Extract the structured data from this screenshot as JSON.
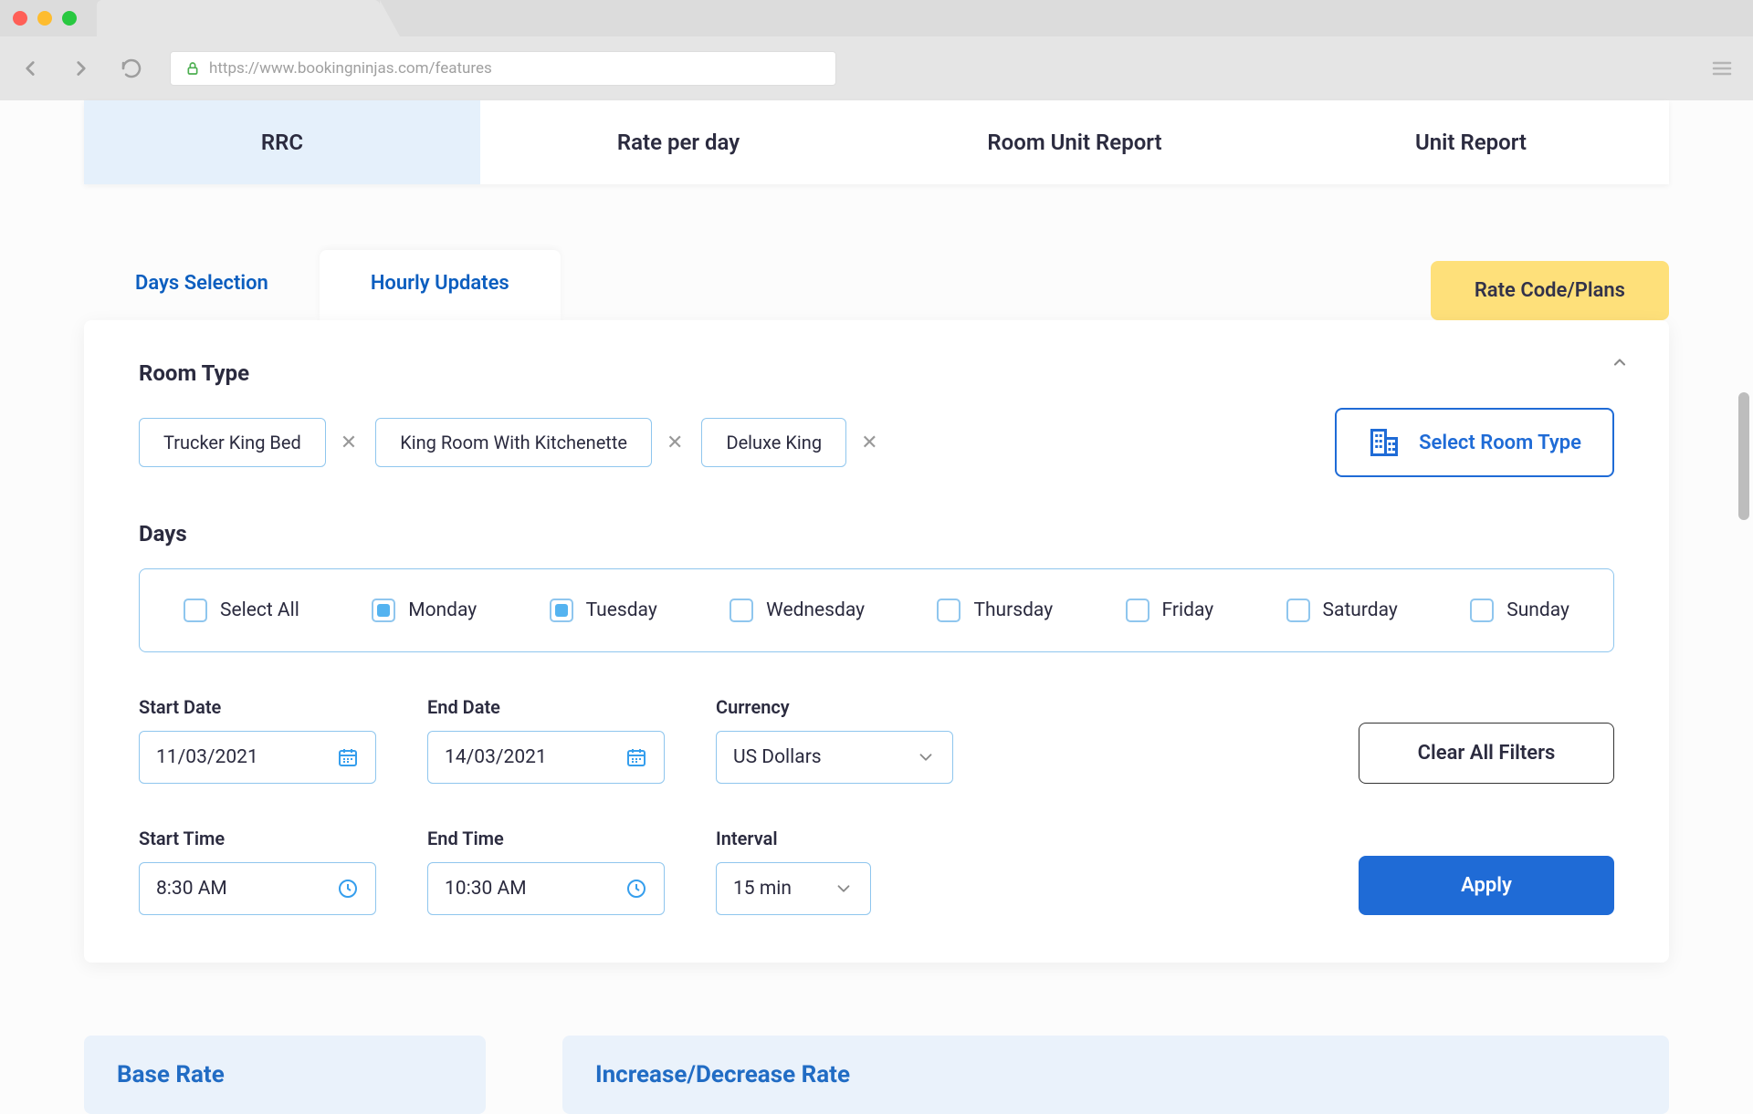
{
  "browser": {
    "url": "https://www.bookingninjas.com/features"
  },
  "main_tabs": {
    "rrc": "RRC",
    "rate_per_day": "Rate per day",
    "room_unit_report": "Room Unit Report",
    "unit_report": "Unit Report"
  },
  "sub_tabs": {
    "days_selection": "Days Selection",
    "hourly_updates": "Hourly Updates"
  },
  "rate_plans_button": "Rate Code/Plans",
  "room_type": {
    "title": "Room Type",
    "chips": [
      "Trucker King Bed",
      "King Room With Kitchenette",
      "Deluxe King"
    ],
    "select_button": "Select Room Type"
  },
  "days": {
    "title": "Days",
    "select_all": "Select All",
    "items": [
      {
        "label": "Monday",
        "checked": true
      },
      {
        "label": "Tuesday",
        "checked": true
      },
      {
        "label": "Wednesday",
        "checked": false
      },
      {
        "label": "Thursday",
        "checked": false
      },
      {
        "label": "Friday",
        "checked": false
      },
      {
        "label": "Saturday",
        "checked": false
      },
      {
        "label": "Sunday",
        "checked": false
      }
    ]
  },
  "fields": {
    "start_date": {
      "label": "Start Date",
      "value": "11/03/2021"
    },
    "end_date": {
      "label": "End Date",
      "value": "14/03/2021"
    },
    "currency": {
      "label": "Currency",
      "value": "US Dollars"
    },
    "start_time": {
      "label": "Start Time",
      "value": "8:30 AM"
    },
    "end_time": {
      "label": "End Time",
      "value": "10:30 AM"
    },
    "interval": {
      "label": "Interval",
      "value": "15 min"
    }
  },
  "buttons": {
    "clear": "Clear All Filters",
    "apply": "Apply"
  },
  "bottom": {
    "base_rate": "Base Rate",
    "increase_decrease": "Increase/Decrease Rate"
  }
}
